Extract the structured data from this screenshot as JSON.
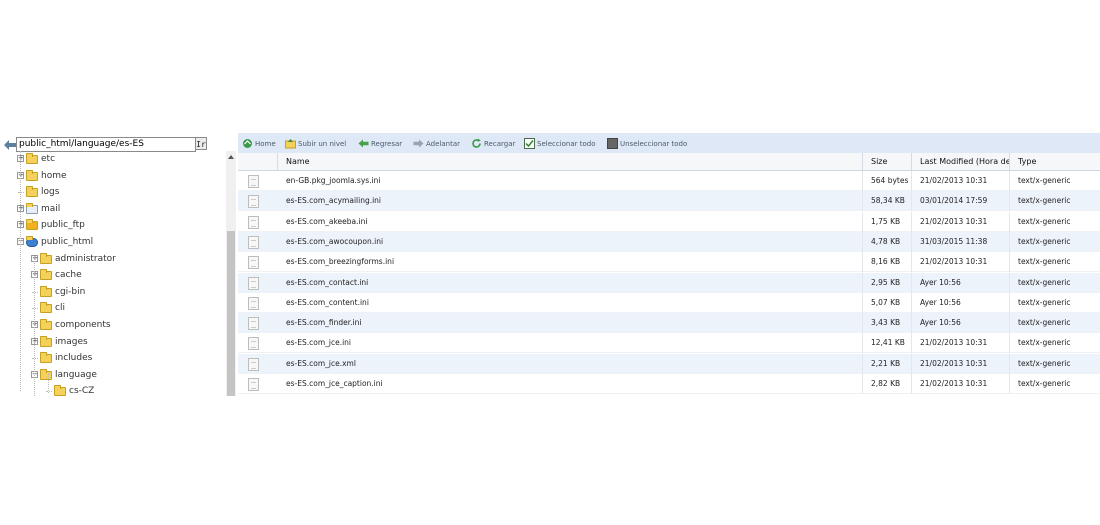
{
  "path_bar": {
    "value": "public_html/language/es-ES",
    "go_label": "Ir"
  },
  "tree": [
    {
      "label": "etc",
      "expander": "+"
    },
    {
      "label": "home",
      "expander": "+"
    },
    {
      "label": "logs",
      "expander": ""
    },
    {
      "label": "mail",
      "expander": "+",
      "icon": "mail-folder-icon"
    },
    {
      "label": "public_ftp",
      "expander": "+",
      "icon": "ftp-folder-icon"
    },
    {
      "label": "public_html",
      "expander": "-",
      "icon": "web-folder-icon"
    },
    {
      "label": "administrator",
      "expander": "+"
    },
    {
      "label": "cache",
      "expander": "+"
    },
    {
      "label": "cgi-bin",
      "expander": ""
    },
    {
      "label": "cli",
      "expander": ""
    },
    {
      "label": "components",
      "expander": "+"
    },
    {
      "label": "images",
      "expander": "+"
    },
    {
      "label": "includes",
      "expander": ""
    },
    {
      "label": "language",
      "expander": "-"
    },
    {
      "label": "cs-CZ",
      "expander": ""
    }
  ],
  "toolbar": {
    "home": "Home",
    "up": "Subir un nivel",
    "back": "Regresar",
    "forward": "Adelantar",
    "reload": "Recargar",
    "select_all": "Seleccionar todo",
    "unselect_all": "Unseleccionar todo"
  },
  "columns": {
    "name": "Name",
    "size": "Size",
    "modified": "Last Modified (Hora de v",
    "type": "Type"
  },
  "files": [
    {
      "name": "en-GB.pkg_joomla.sys.ini",
      "size": "564 bytes",
      "modified": "21/02/2013 10:31",
      "type": "text/x-generic"
    },
    {
      "name": "es-ES.com_acymailing.ini",
      "size": "58,34 KB",
      "modified": "03/01/2014 17:59",
      "type": "text/x-generic"
    },
    {
      "name": "es-ES.com_akeeba.ini",
      "size": "1,75 KB",
      "modified": "21/02/2013 10:31",
      "type": "text/x-generic"
    },
    {
      "name": "es-ES.com_awocoupon.ini",
      "size": "4,78 KB",
      "modified": "31/03/2015 11:38",
      "type": "text/x-generic"
    },
    {
      "name": "es-ES.com_breezingforms.ini",
      "size": "8,16 KB",
      "modified": "21/02/2013 10:31",
      "type": "text/x-generic"
    },
    {
      "name": "es-ES.com_contact.ini",
      "size": "2,95 KB",
      "modified": "Ayer 10:56",
      "type": "text/x-generic"
    },
    {
      "name": "es-ES.com_content.ini",
      "size": "5,07 KB",
      "modified": "Ayer 10:56",
      "type": "text/x-generic"
    },
    {
      "name": "es-ES.com_finder.ini",
      "size": "3,43 KB",
      "modified": "Ayer 10:56",
      "type": "text/x-generic"
    },
    {
      "name": "es-ES.com_jce.ini",
      "size": "12,41 KB",
      "modified": "21/02/2013 10:31",
      "type": "text/x-generic"
    },
    {
      "name": "es-ES.com_jce.xml",
      "size": "2,21 KB",
      "modified": "21/02/2013 10:31",
      "type": "text/x-generic"
    },
    {
      "name": "es-ES.com_jce_caption.ini",
      "size": "2,82 KB",
      "modified": "21/02/2013 10:31",
      "type": "text/x-generic"
    }
  ],
  "colors": {
    "toolbar_bg": "#dfe8f6",
    "row_alt": "#edf3fb",
    "folder": "#f3d15b"
  }
}
